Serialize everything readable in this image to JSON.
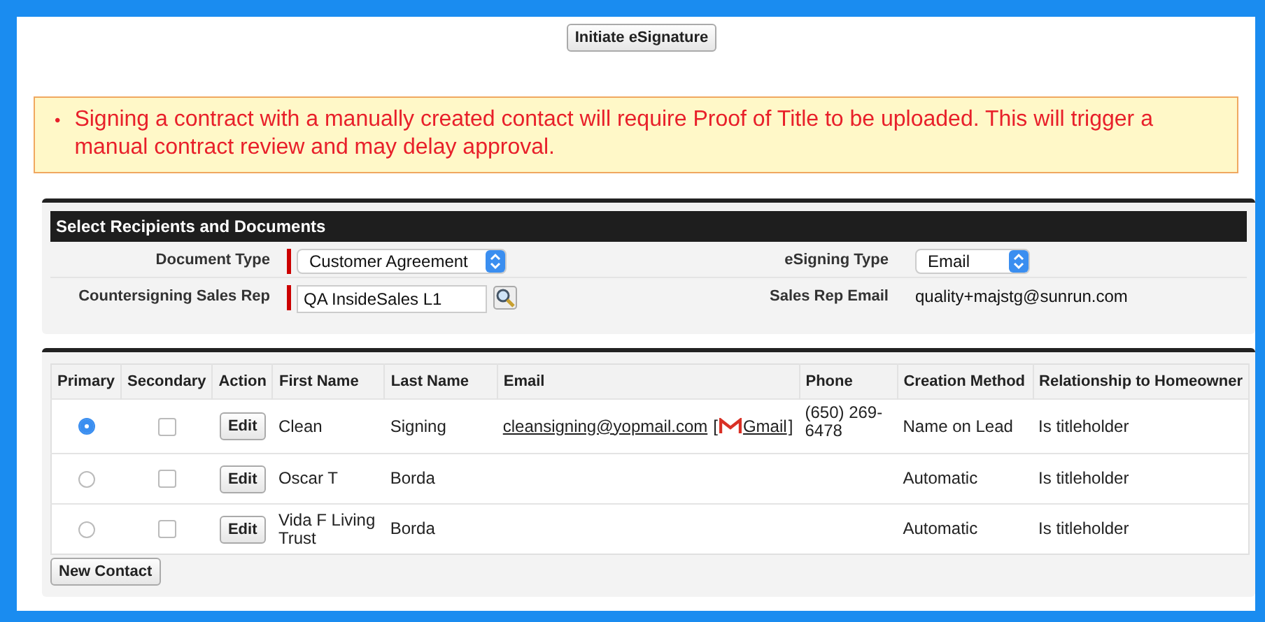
{
  "toolbar": {
    "button": "Initiate eSignature"
  },
  "alert": {
    "bullet": "•",
    "messages": [
      "Signing a contract with a manually created contact will require Proof of Title to be uploaded. This will trigger a manual contract review and may delay approval."
    ]
  },
  "recipients": {
    "title": "Select Recipients and Documents",
    "fields": [
      {
        "label": "Document Type",
        "kind": "select",
        "value": "Customer Agreement",
        "required": true
      },
      {
        "label": "eSigning Type",
        "kind": "select",
        "value": "Email",
        "required": false
      },
      {
        "label": "Countersigning Sales Rep",
        "kind": "lookup",
        "value": "QA InsideSales L1",
        "required": true
      },
      {
        "label": "Sales Rep Email",
        "kind": "text",
        "value": "quality+majstg@sunrun.com",
        "required": false
      }
    ]
  },
  "contacts": {
    "columns": [
      "Primary",
      "Secondary",
      "Action",
      "First Name",
      "Last Name",
      "Email",
      "Phone",
      "Creation Method",
      "Relationship to Homeowner"
    ],
    "rows": [
      {
        "primary": true,
        "secondary": false,
        "action": "Edit",
        "first_name": "Clean",
        "last_name": "Signing",
        "email": {
          "address": "cleansigning@yopmail.com",
          "open": "[",
          "link": "Gmail",
          "close": "]"
        },
        "phone": "(650) 269-6478",
        "creation_method": "Name on Lead",
        "relationship": "Is titleholder"
      },
      {
        "primary": false,
        "secondary": false,
        "action": "Edit",
        "first_name": "Oscar T",
        "last_name": "Borda",
        "creation_method": "Automatic",
        "relationship": "Is titleholder"
      },
      {
        "primary": false,
        "secondary": false,
        "action": "Edit",
        "first_name": "Vida F Living Trust",
        "last_name": "Borda",
        "creation_method": "Automatic",
        "relationship": "Is titleholder"
      }
    ],
    "new_button": "New Contact"
  }
}
